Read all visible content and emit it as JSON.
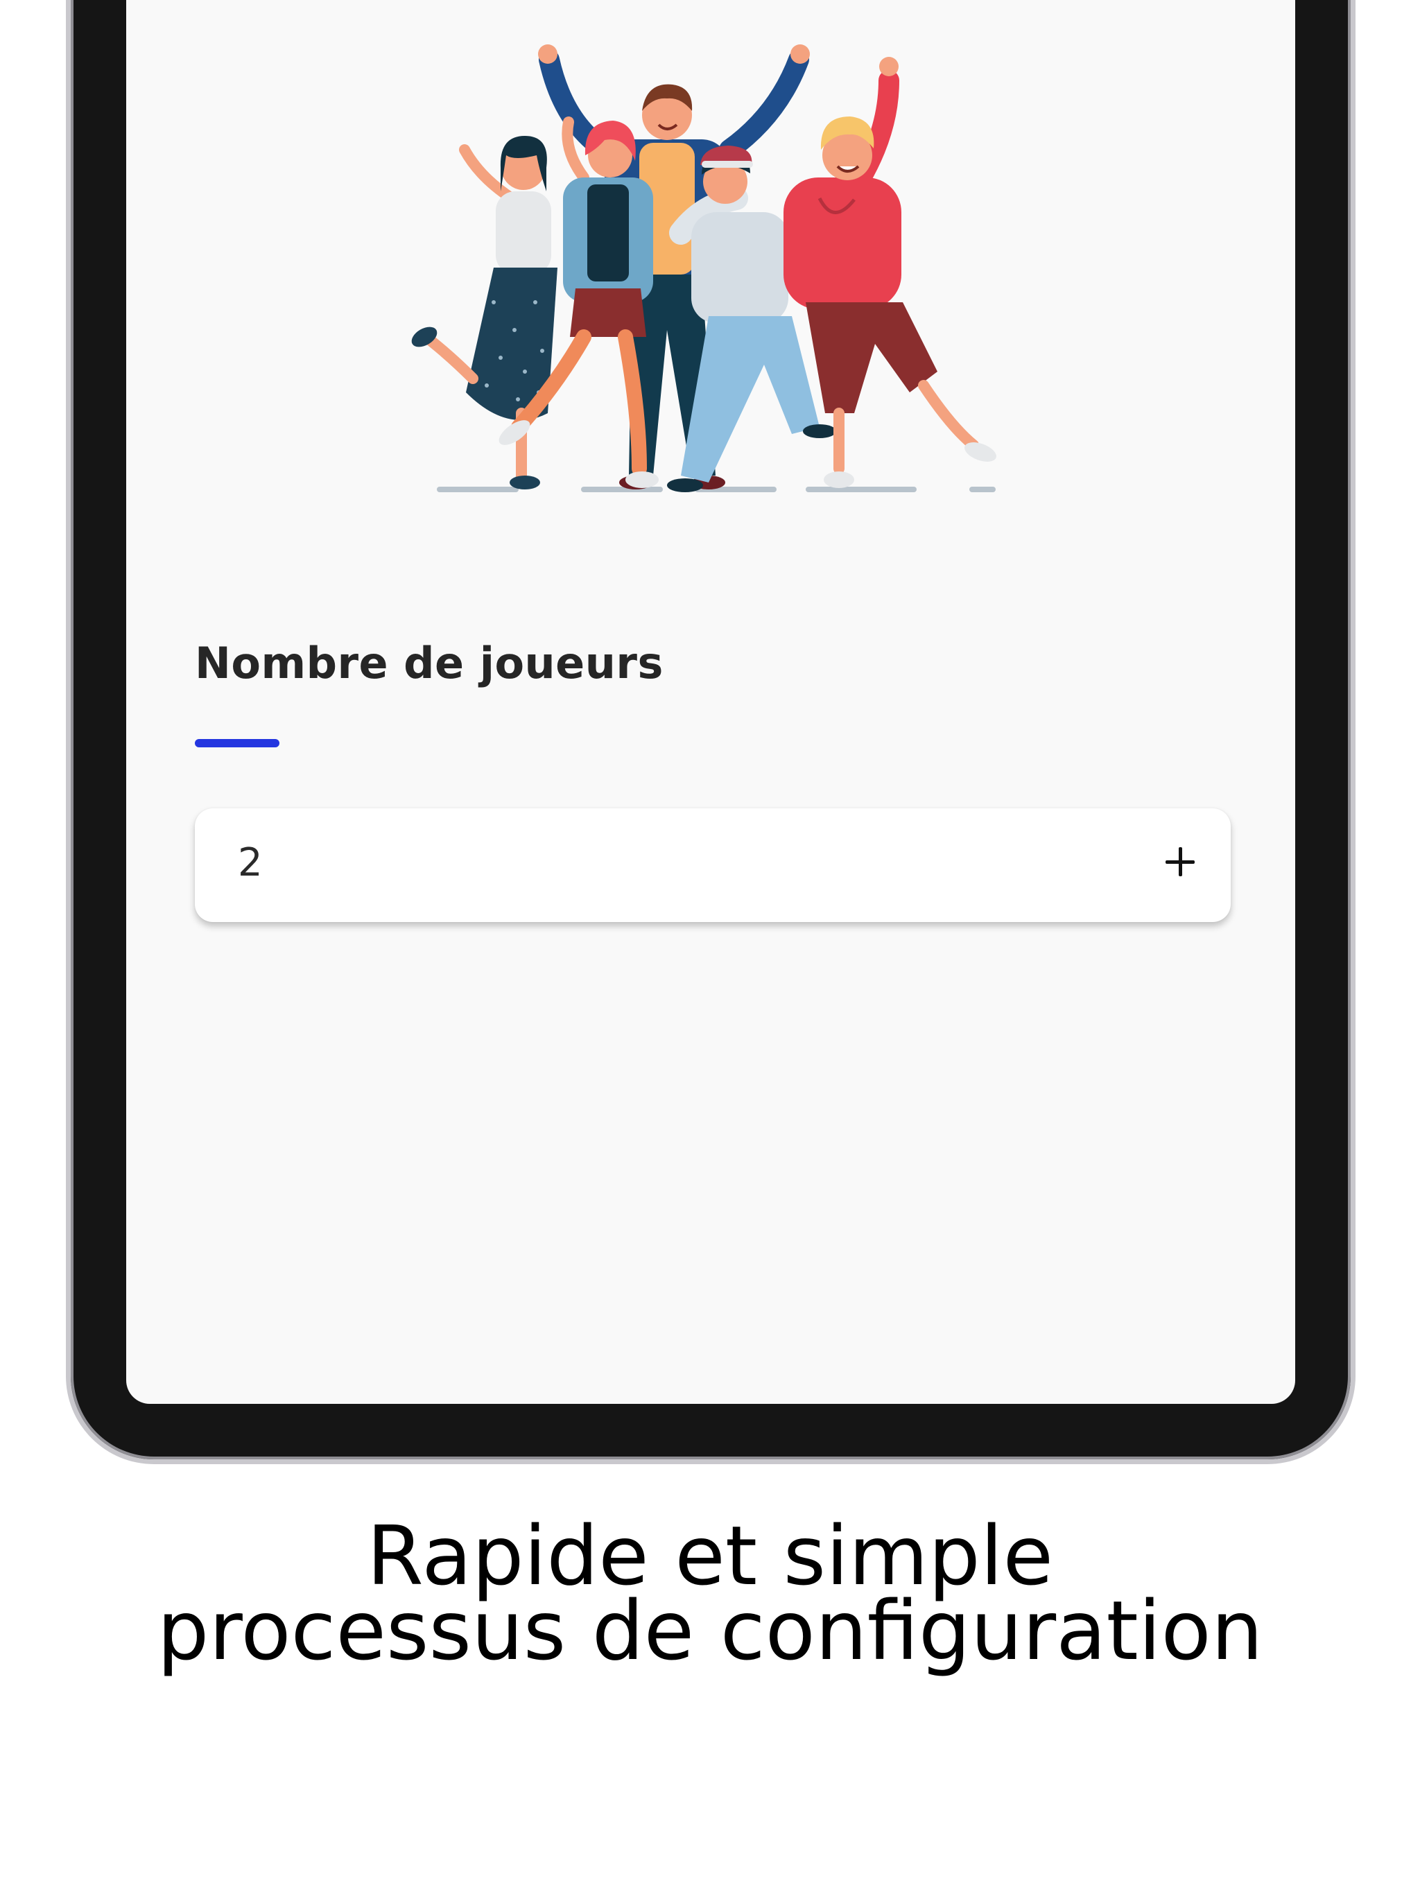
{
  "screen": {
    "section_title": "Nombre de joueurs",
    "players_stepper": {
      "value": "2",
      "increment_icon": "plus-icon"
    },
    "illustration": "group-of-friends-illustration"
  },
  "caption": {
    "line1": "Rapide et simple",
    "line2": "processus de configuration"
  },
  "colors": {
    "accent": "#2436e0",
    "screen_background": "#f9f9f9",
    "device_frame": "#151515"
  }
}
